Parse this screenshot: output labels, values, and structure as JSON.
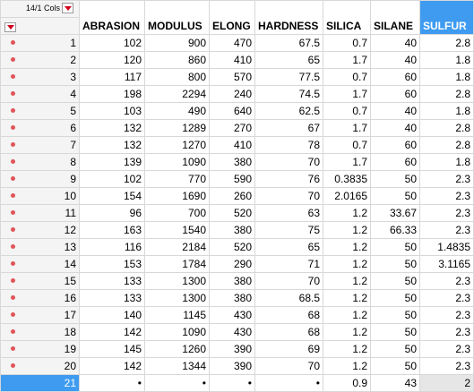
{
  "table": {
    "cols_label": "14/1 Cols",
    "columns": [
      "ABRASION",
      "MODULUS",
      "ELONG",
      "HARDNESS",
      "SILICA",
      "SILANE",
      "SULFUR"
    ],
    "selected_column": "SULFUR",
    "selected_row": "21",
    "rows": [
      {
        "row": "1",
        "marker": true,
        "cells": [
          "102",
          "900",
          "470",
          "67.5",
          "0.7",
          "40",
          "2.8"
        ]
      },
      {
        "row": "2",
        "marker": true,
        "cells": [
          "120",
          "860",
          "410",
          "65",
          "1.7",
          "40",
          "1.8"
        ]
      },
      {
        "row": "3",
        "marker": true,
        "cells": [
          "117",
          "800",
          "570",
          "77.5",
          "0.7",
          "60",
          "1.8"
        ]
      },
      {
        "row": "4",
        "marker": true,
        "cells": [
          "198",
          "2294",
          "240",
          "74.5",
          "1.7",
          "60",
          "2.8"
        ]
      },
      {
        "row": "5",
        "marker": true,
        "cells": [
          "103",
          "490",
          "640",
          "62.5",
          "0.7",
          "40",
          "1.8"
        ]
      },
      {
        "row": "6",
        "marker": true,
        "cells": [
          "132",
          "1289",
          "270",
          "67",
          "1.7",
          "40",
          "2.8"
        ]
      },
      {
        "row": "7",
        "marker": true,
        "cells": [
          "132",
          "1270",
          "410",
          "78",
          "0.7",
          "60",
          "2.8"
        ]
      },
      {
        "row": "8",
        "marker": true,
        "cells": [
          "139",
          "1090",
          "380",
          "70",
          "1.7",
          "60",
          "1.8"
        ]
      },
      {
        "row": "9",
        "marker": true,
        "cells": [
          "102",
          "770",
          "590",
          "76",
          "0.3835",
          "50",
          "2.3"
        ]
      },
      {
        "row": "10",
        "marker": true,
        "cells": [
          "154",
          "1690",
          "260",
          "70",
          "2.0165",
          "50",
          "2.3"
        ]
      },
      {
        "row": "11",
        "marker": true,
        "cells": [
          "96",
          "700",
          "520",
          "63",
          "1.2",
          "33.67",
          "2.3"
        ]
      },
      {
        "row": "12",
        "marker": true,
        "cells": [
          "163",
          "1540",
          "380",
          "75",
          "1.2",
          "66.33",
          "2.3"
        ]
      },
      {
        "row": "13",
        "marker": true,
        "cells": [
          "116",
          "2184",
          "520",
          "65",
          "1.2",
          "50",
          "1.4835"
        ]
      },
      {
        "row": "14",
        "marker": true,
        "cells": [
          "153",
          "1784",
          "290",
          "71",
          "1.2",
          "50",
          "3.1165"
        ]
      },
      {
        "row": "15",
        "marker": true,
        "cells": [
          "133",
          "1300",
          "380",
          "70",
          "1.2",
          "50",
          "2.3"
        ]
      },
      {
        "row": "16",
        "marker": true,
        "cells": [
          "133",
          "1300",
          "380",
          "68.5",
          "1.2",
          "50",
          "2.3"
        ]
      },
      {
        "row": "17",
        "marker": true,
        "cells": [
          "140",
          "1145",
          "430",
          "68",
          "1.2",
          "50",
          "2.3"
        ]
      },
      {
        "row": "18",
        "marker": true,
        "cells": [
          "142",
          "1090",
          "430",
          "68",
          "1.2",
          "50",
          "2.3"
        ]
      },
      {
        "row": "19",
        "marker": true,
        "cells": [
          "145",
          "1260",
          "390",
          "69",
          "1.2",
          "50",
          "2.3"
        ]
      },
      {
        "row": "20",
        "marker": true,
        "cells": [
          "142",
          "1344",
          "390",
          "70",
          "1.2",
          "50",
          "2.3"
        ]
      },
      {
        "row": "21",
        "marker": false,
        "cells": [
          "•",
          "•",
          "•",
          "•",
          "0.9",
          "43",
          "2"
        ]
      }
    ]
  },
  "colors": {
    "selection": "#3e9bf0",
    "marker": "#e0545a",
    "menu_arrow": "#d0021b"
  }
}
